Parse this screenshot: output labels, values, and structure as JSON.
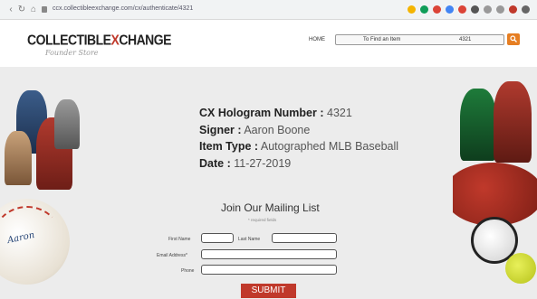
{
  "browser": {
    "url": "ccx.collectibleexchange.com/cx/authenticate/4321"
  },
  "header": {
    "logo_part1": "COLLECTIBLE",
    "logo_x": "X",
    "logo_part2": "CHANGE",
    "logo_sub": "Founder Store",
    "home_label": "HOME",
    "search_placeholder": "To Find an Item",
    "search_value": "4321"
  },
  "hologram": {
    "number_label": "CX Hologram Number :",
    "number_value": "4321",
    "signer_label": "Signer :",
    "signer_value": "Aaron Boone",
    "item_type_label": "Item Type :",
    "item_type_value": "Autographed MLB Baseball",
    "date_label": "Date :",
    "date_value": "11-27-2019"
  },
  "mailing": {
    "title": "Join Our Mailing List",
    "required_note": "* required fields",
    "first_name_label": "First Name",
    "last_name_label": "Last Name",
    "email_label": "Email Address*",
    "phone_label": "Phone",
    "submit_label": "SUBMIT"
  },
  "colors": {
    "accent_orange": "#e67e22",
    "submit_red": "#c0392b",
    "band_gray": "#ececec"
  }
}
